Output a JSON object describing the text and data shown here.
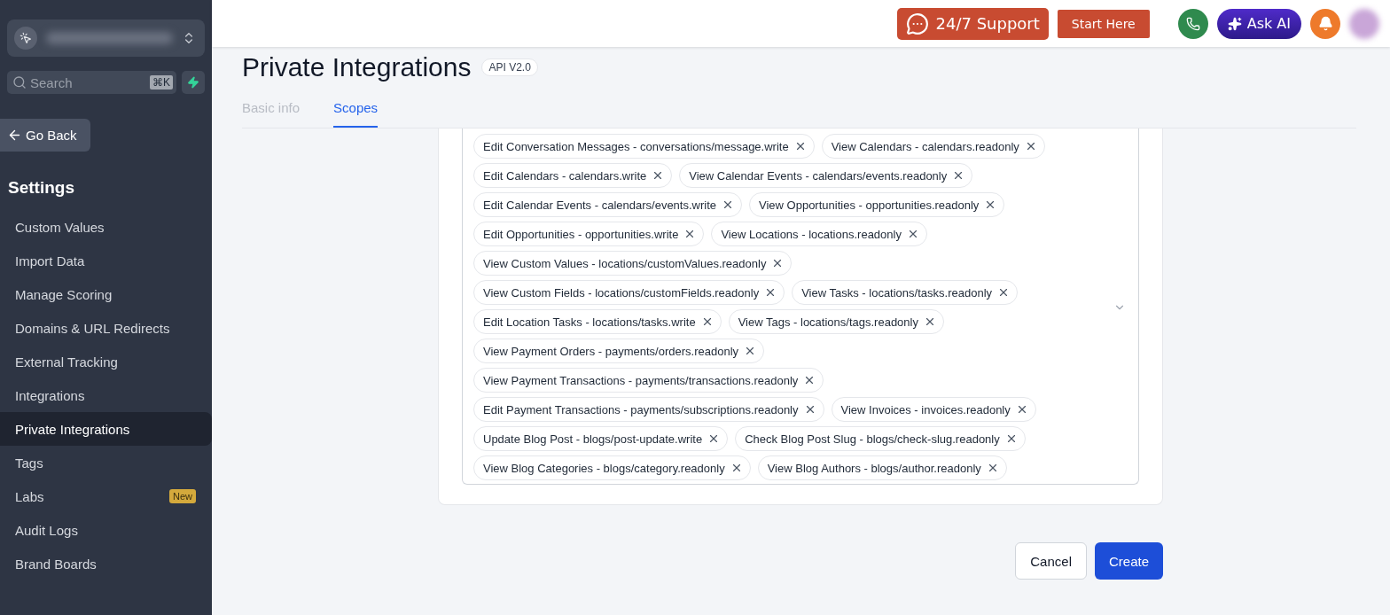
{
  "sidebar": {
    "search": {
      "placeholder": "Search",
      "shortcut": "⌘K"
    },
    "back_button": "Go Back",
    "section_title": "Settings",
    "items": [
      {
        "label": "Custom Values",
        "selected": false
      },
      {
        "label": "Import Data",
        "selected": false
      },
      {
        "label": "Manage Scoring",
        "selected": false
      },
      {
        "label": "Domains & URL Redirects",
        "selected": false
      },
      {
        "label": "External Tracking",
        "selected": false
      },
      {
        "label": "Integrations",
        "selected": false
      },
      {
        "label": "Private Integrations",
        "selected": true
      },
      {
        "label": "Tags",
        "selected": false
      },
      {
        "label": "Labs",
        "selected": false,
        "badge": "New"
      },
      {
        "label": "Audit Logs",
        "selected": false
      },
      {
        "label": "Brand Boards",
        "selected": false
      }
    ]
  },
  "header": {
    "support_button": "24/7 Support",
    "start_button": "Start Here",
    "ask_ai_button": "Ask AI"
  },
  "page": {
    "title": "Private Integrations",
    "api_badge": "API V2.0",
    "tabs": [
      {
        "label": "Basic info",
        "selected": false
      },
      {
        "label": "Scopes",
        "selected": true
      }
    ],
    "scopes": [
      "Edit Conversation Messages - conversations/message.write",
      "View Calendars - calendars.readonly",
      "Edit Calendars - calendars.write",
      "View Calendar Events - calendars/events.readonly",
      "Edit Calendar Events - calendars/events.write",
      "View Opportunities - opportunities.readonly",
      "Edit Opportunities - opportunities.write",
      "View Locations - locations.readonly",
      "View Custom Values - locations/customValues.readonly",
      "View Custom Fields - locations/customFields.readonly",
      "View Tasks - locations/tasks.readonly",
      "Edit Location Tasks - locations/tasks.write",
      "View Tags - locations/tags.readonly",
      "View Payment Orders - payments/orders.readonly",
      "View Payment Transactions - payments/transactions.readonly",
      "Edit Payment Transactions - payments/subscriptions.readonly",
      "View Invoices - invoices.readonly",
      "Update Blog Post - blogs/post-update.write",
      "Check Blog Post Slug - blogs/check-slug.readonly",
      "View Blog Categories - blogs/category.readonly",
      "View Blog Authors - blogs/author.readonly"
    ],
    "cancel_button": "Cancel",
    "create_button": "Create"
  }
}
